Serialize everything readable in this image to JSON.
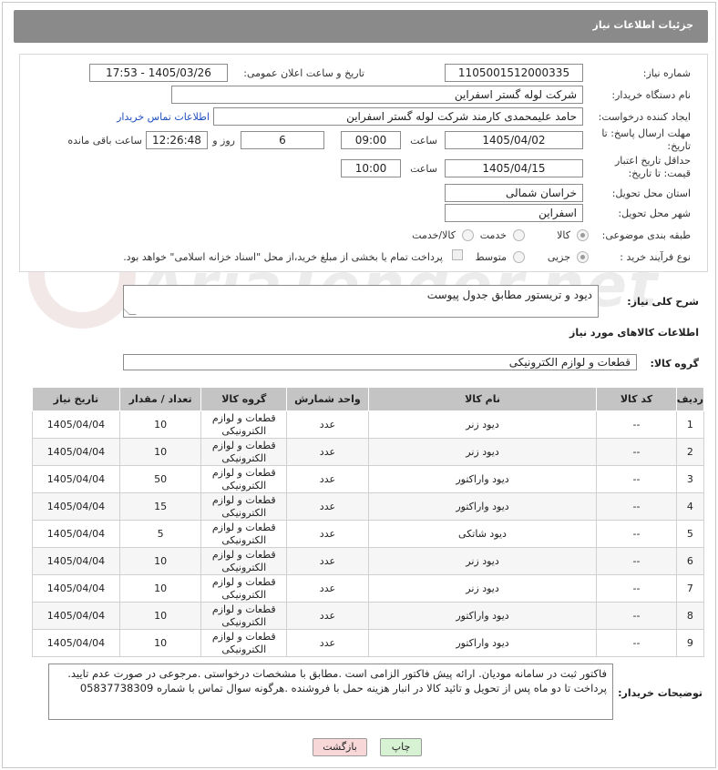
{
  "header": {
    "title": "جزئیات اطلاعات نیاز"
  },
  "form": {
    "need_number_label": "شماره نیاز:",
    "need_number": "1105001512000335",
    "announce_label": "تاریخ و ساعت اعلان عمومی:",
    "announce_value": "1405/03/26 - 17:53",
    "buyer_org_label": "نام دستگاه خریدار:",
    "buyer_org": "شرکت لوله گستر اسفراین",
    "creator_label": "ایجاد کننده درخواست:",
    "creator": "حامد علیمحمدی کارمند شرکت لوله گستر اسفراین",
    "contact_link": "اطلاعات تماس خریدار",
    "reply_deadline_label": "مهلت ارسال پاسخ: تا تاریخ:",
    "reply_date": "1405/04/02",
    "time_label": "ساعت",
    "reply_time": "09:00",
    "days_value": "6",
    "days_label": "روز و",
    "remaining_time": "12:26:48",
    "remaining_label": "ساعت باقی مانده",
    "price_validity_label": "حداقل تاریخ اعتبار قیمت: تا تاریخ:",
    "price_date": "1405/04/15",
    "price_time": "10:00",
    "province_label": "استان محل تحویل:",
    "province": "خراسان شمالی",
    "city_label": "شهر محل تحویل:",
    "city": "اسفراین",
    "category_label": "طبقه بندی موضوعی:",
    "category_options": [
      "کالا",
      "خدمت",
      "کالا/خدمت"
    ],
    "process_label": "نوع فرآیند خرید :",
    "process_options": [
      "جزیی",
      "متوسط"
    ],
    "payment_note": "پرداخت تمام یا بخشی از مبلغ خرید،از محل \"اسناد خزانه اسلامی\" خواهد بود."
  },
  "description": {
    "label": "شرح کلی نیاز:",
    "text": "دیود و تریستور مطابق جدول پیوست"
  },
  "goods_info": {
    "title": "اطلاعات کالاهای مورد نیاز",
    "group_label": "گروه کالا:",
    "group_value": "قطعات و لوازم الکترونیکی"
  },
  "table": {
    "headers": [
      "ردیف",
      "کد کالا",
      "نام کالا",
      "واحد شمارش",
      "گروه کالا",
      "تعداد / مقدار",
      "تاریخ نیاز"
    ],
    "rows": [
      [
        "1",
        "--",
        "دیود زنر",
        "عدد",
        "قطعات و لوازم الکترونیکی",
        "10",
        "1405/04/04"
      ],
      [
        "2",
        "--",
        "دیود زنر",
        "عدد",
        "قطعات و لوازم الکترونیکی",
        "10",
        "1405/04/04"
      ],
      [
        "3",
        "--",
        "دیود واراکتور",
        "عدد",
        "قطعات و لوازم الکترونیکی",
        "50",
        "1405/04/04"
      ],
      [
        "4",
        "--",
        "دیود واراکتور",
        "عدد",
        "قطعات و لوازم الکترونیکی",
        "15",
        "1405/04/04"
      ],
      [
        "5",
        "--",
        "دیود شاتکی",
        "عدد",
        "قطعات و لوازم الکترونیکی",
        "5",
        "1405/04/04"
      ],
      [
        "6",
        "--",
        "دیود زنر",
        "عدد",
        "قطعات و لوازم الکترونیکی",
        "10",
        "1405/04/04"
      ],
      [
        "7",
        "--",
        "دیود زنر",
        "عدد",
        "قطعات و لوازم الکترونیکی",
        "10",
        "1405/04/04"
      ],
      [
        "8",
        "--",
        "دیود واراکتور",
        "عدد",
        "قطعات و لوازم الکترونیکی",
        "10",
        "1405/04/04"
      ],
      [
        "9",
        "--",
        "دیود واراکتور",
        "عدد",
        "قطعات و لوازم الکترونیکی",
        "10",
        "1405/04/04"
      ]
    ]
  },
  "buyer_notes": {
    "label": "توضیحات خریدار:",
    "text": "فاکتور ثبت در سامانه مودیان. ارائه پیش فاکتور الزامی است .مطابق با مشخصات درخواستی .مرجوعی در صورت عدم تایید. پرداخت تا دو ماه پس از تحویل و تائید کالا در انبار  هزینه حمل با فروشنده .هرگونه سوال تماس با شماره 05837738309"
  },
  "buttons": {
    "print": "چاپ",
    "back": "بازگشت"
  },
  "colors": {
    "header_bg": "#8a8a8a",
    "table_header_bg": "#c4c4c4",
    "link": "#1f4fbf",
    "back_btn_bg": "#f7d7d7",
    "print_btn_bg": "#d6f2d3"
  },
  "watermark": "AriaTender.net"
}
